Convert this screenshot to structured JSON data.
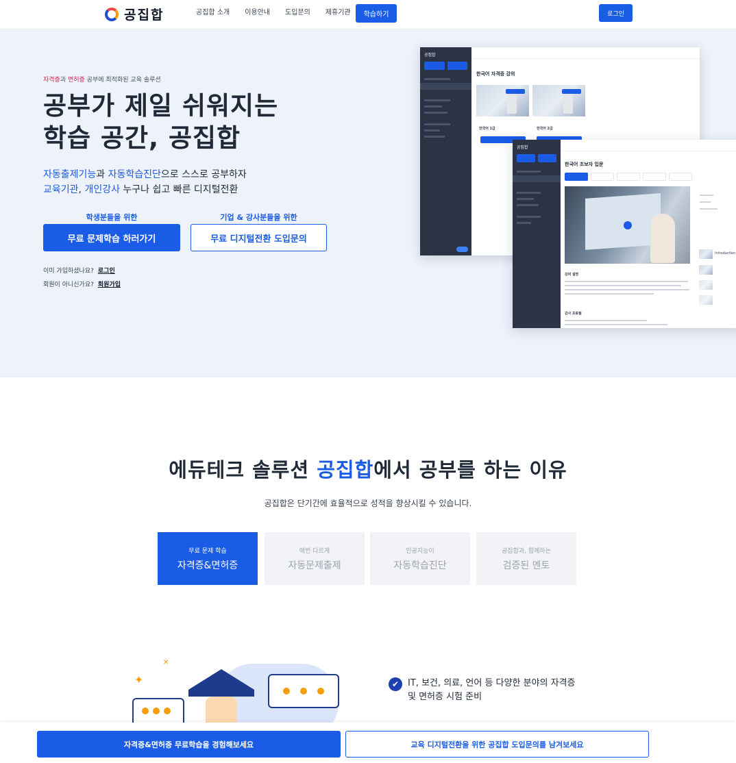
{
  "header": {
    "logo_text": "공집합",
    "nav": [
      "공집합 소개",
      "이용안내",
      "도입문의",
      "제휴기관"
    ],
    "nav_cta": "학습하기",
    "login": "로그인"
  },
  "hero": {
    "eyebrow_part1": "자격증",
    "eyebrow_part2": "과 ",
    "eyebrow_part3": "면허증",
    "eyebrow_part4": " 공부에 최적화된 교육 솔루션",
    "title_line1": "공부가 제일 쉬워지는",
    "title_line2": "학습 공간, 공집합",
    "sub1_a": "자동출제기능",
    "sub1_b": "과 ",
    "sub1_c": "자동학습진단",
    "sub1_d": "으로 스스로 공부하자",
    "sub2_a": "교육기관",
    "sub2_b": ", ",
    "sub2_c": "개인강사",
    "sub2_d": " 누구나 쉽고 빠른 디지털전환",
    "student_caption": "학생분들을 위한",
    "student_button": "무료 문제학습 하러가기",
    "company_caption": "기업 & 강사분들을 위한",
    "company_button": "무료 디지털전환 도입문의",
    "member_q": "이미 가입하셨나요?",
    "member_link": "로그인",
    "nonmember_q": "회원이 아니신가요?",
    "nonmember_link": "회원가입"
  },
  "mockup": {
    "logo": "공집합",
    "course_title_1": "한국어 자격증 강의",
    "card1": "한국어 1급",
    "card2": "한국어 2급",
    "course_title_2": "한국어 초보자 입문",
    "section_desc": "강의 설명",
    "section_teacher": "강사 프로필",
    "playlist_item": "Introduction"
  },
  "section2": {
    "title_a": "에듀테크 솔루션 ",
    "title_b": "공집합",
    "title_c": "에서 공부를 하는 이유",
    "subtitle": "공집합은 단기간에 효율적으로 성적을 향상시킬 수 있습니다.",
    "features": [
      {
        "caption": "무료 문제 학습",
        "label": "자격증&면허증"
      },
      {
        "caption": "매번 다르게",
        "label": "자동문제출제"
      },
      {
        "caption": "인공지능이",
        "label": "자동학습진단"
      },
      {
        "caption": "공집합과, 함께하는",
        "label": "검증된 멘토"
      }
    ]
  },
  "section3": {
    "check_icon": "check-circle-icon",
    "point1_line1": "IT, 보건, 의료, 언어 등 다양한 분야의 자격증",
    "point1_line2": "및 면허증 시험 준비"
  },
  "bottom_bar": {
    "primary": "자격증&면허증 무료학습을 경험해보세요",
    "outline": "교육 디지털전환을 위한 공집합 도입문의를 남겨보세요"
  },
  "colors": {
    "brand_blue": "#1a5ce6",
    "accent_pink": "#e11d48",
    "hero_bg": "#eef2fb"
  }
}
